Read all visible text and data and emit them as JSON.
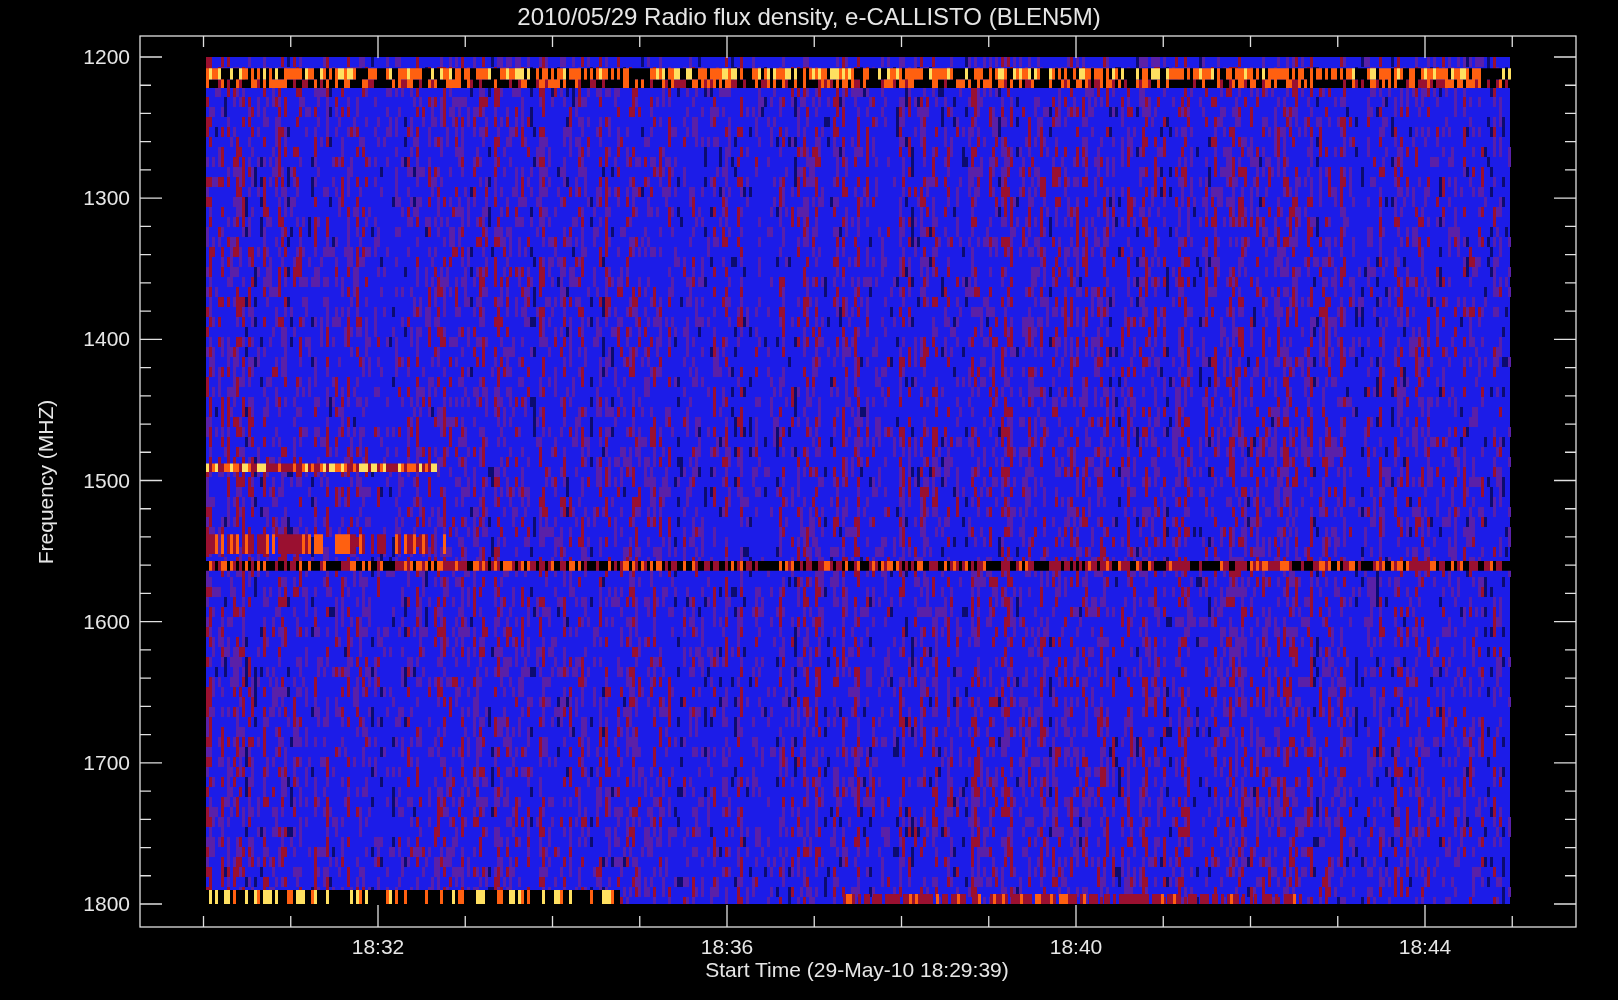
{
  "title": "2010/05/29  Radio flux density, e-CALLISTO (BLEN5M)",
  "y_axis": {
    "label": "Frequency (MHZ)",
    "ticks": [
      "1200",
      "1300",
      "1400",
      "1500",
      "1600",
      "1700",
      "1800"
    ]
  },
  "x_axis": {
    "label": "Start Time (29-May-10 18:29:39)",
    "ticks": [
      "18:32",
      "18:36",
      "18:40",
      "18:44"
    ]
  }
}
